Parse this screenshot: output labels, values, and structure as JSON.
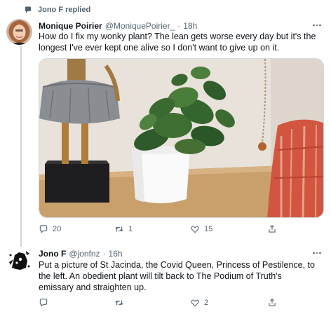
{
  "context": {
    "text": "Jono F replied",
    "icon": "comment-icon"
  },
  "tweets": [
    {
      "name": "Monique Poirier",
      "handle": "@MoniquePoirier_",
      "separator": "·",
      "time": "18h",
      "text": "How do I fix my wonky plant? The lean gets worse every day but it's the longest I've ever kept one alive so I don't want to give up on it.",
      "actions": {
        "reply": "20",
        "retweet": "1",
        "like": "15"
      }
    },
    {
      "name": "Jono F",
      "handle": "@jonfnz",
      "separator": "·",
      "time": "16h",
      "text": "Put a picture of St Jacinda, the Covid Queen, Princess of Pestilence, to the left. An obedient plant will tilt back to The Podium of Truth's emissary and straighten up.",
      "actions": {
        "reply": "",
        "retweet": "",
        "like": "2"
      }
    }
  ],
  "colors": {
    "text": "#0f1419",
    "secondary": "#536471",
    "border": "#cfd9de"
  }
}
